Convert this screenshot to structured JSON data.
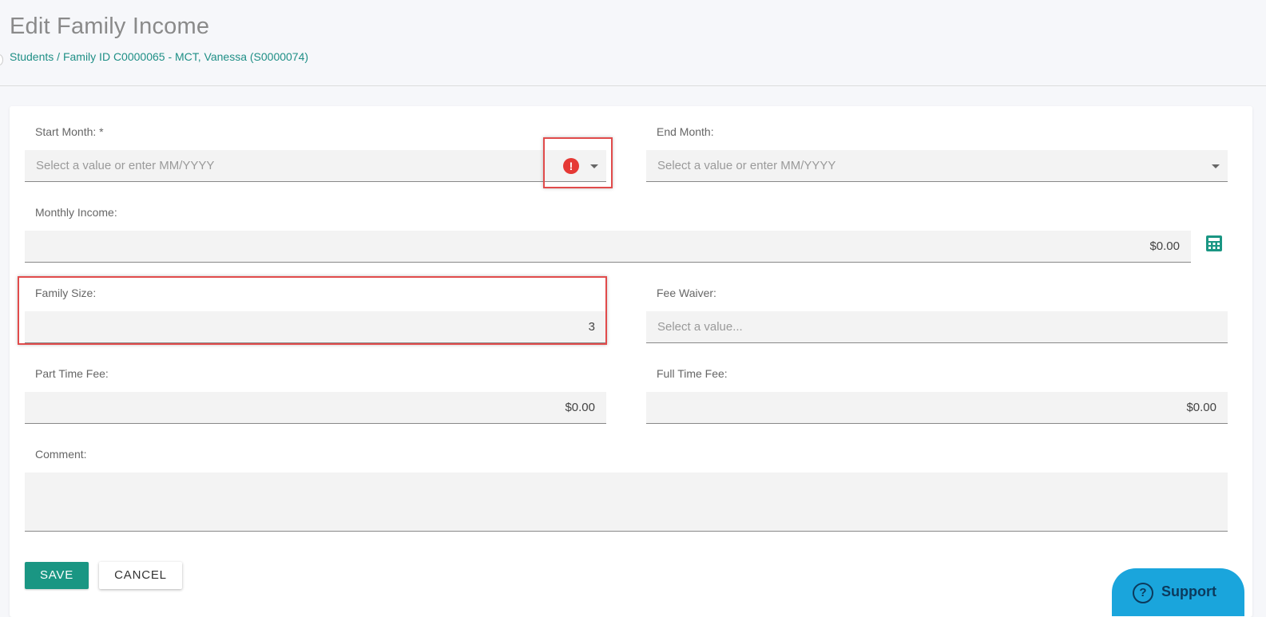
{
  "header": {
    "title": "Edit Family Income",
    "breadcrumb": {
      "students": "Students",
      "sep": "/",
      "family": "Family ID C0000065 - MCT, Vanessa (S0000074)"
    }
  },
  "form": {
    "start_month": {
      "label": "Start Month: *",
      "placeholder": "Select a value or enter MM/YYYY",
      "error_icon": "!"
    },
    "end_month": {
      "label": "End Month:",
      "placeholder": "Select a value or enter MM/YYYY"
    },
    "monthly_income": {
      "label": "Monthly Income:",
      "value": "$0.00"
    },
    "family_size": {
      "label": "Family Size:",
      "value": "3"
    },
    "fee_waiver": {
      "label": "Fee Waiver:",
      "placeholder": "Select a value..."
    },
    "part_time_fee": {
      "label": "Part Time Fee:",
      "value": "$0.00"
    },
    "full_time_fee": {
      "label": "Full Time Fee:",
      "value": "$0.00"
    },
    "comment": {
      "label": "Comment:",
      "value": ""
    }
  },
  "actions": {
    "save": "SAVE",
    "cancel": "CANCEL"
  },
  "support": {
    "icon": "?",
    "label": "Support"
  },
  "colors": {
    "accent": "#1a9683",
    "link": "#1f8f86",
    "error": "#e53935",
    "highlight_box": "#e14b4b",
    "support_bg": "#1aa5dc"
  }
}
